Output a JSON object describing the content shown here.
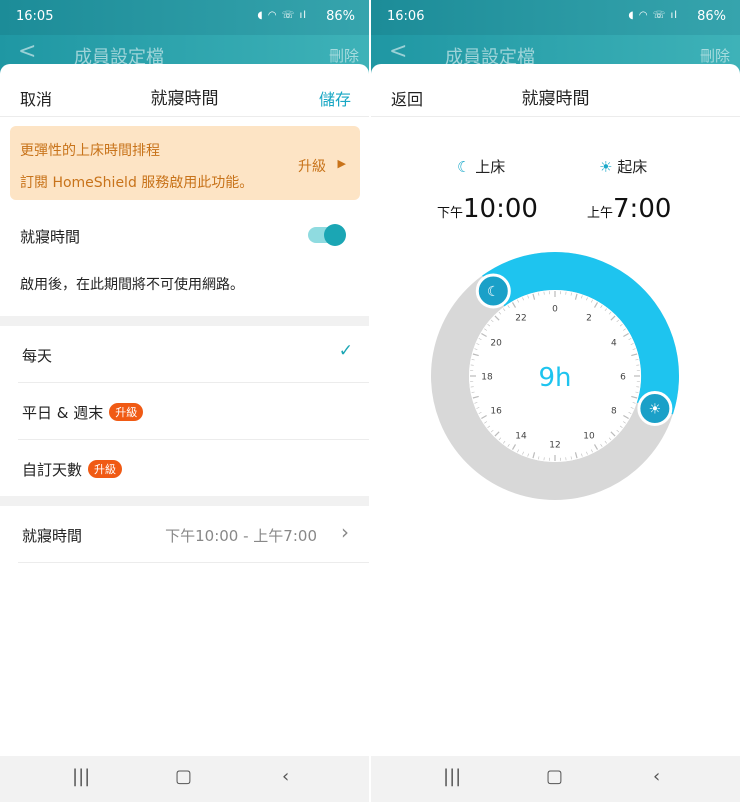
{
  "left": {
    "status": {
      "time": "16:05",
      "battery": "86%"
    },
    "nav": {
      "back_icon": "chevron-left-icon",
      "title": "成員設定檔",
      "delete": "刪除"
    },
    "sheet": {
      "cancel": "取消",
      "title": "就寢時間",
      "save": "儲存",
      "banner": {
        "line1": "更彈性的上床時間排程",
        "line2": "訂閱 HomeShield 服務啟用此功能。",
        "upgrade": "升級"
      },
      "toggle_label": "就寢時間",
      "toggle_on": true,
      "description": "啟用後，在此期間將不可使用網路。",
      "options": [
        {
          "label": "每天",
          "selected": true
        },
        {
          "label": "平日 & 週末",
          "badge": "升級"
        },
        {
          "label": "自訂天數",
          "badge": "升級"
        }
      ],
      "schedule_label": "就寢時間",
      "schedule_value": "下午10:00 - 上午7:00"
    }
  },
  "right": {
    "status": {
      "time": "16:06",
      "battery": "86%"
    },
    "nav": {
      "title": "成員設定檔",
      "delete": "刪除"
    },
    "sheet": {
      "back": "返回",
      "title": "就寢時間",
      "bed_label": "上床",
      "wake_label": "起床",
      "bed_prefix": "下午",
      "bed_time": "10:00",
      "wake_prefix": "上午",
      "wake_time": "7:00",
      "duration": "9h",
      "dial_numbers": [
        "0",
        "2",
        "4",
        "6",
        "8",
        "10",
        "12",
        "14",
        "16",
        "18",
        "20",
        "22"
      ],
      "accent": "#1ec4ef"
    }
  },
  "bottom_nav": {
    "recent": "|||",
    "home": "▢",
    "back": "‹"
  }
}
